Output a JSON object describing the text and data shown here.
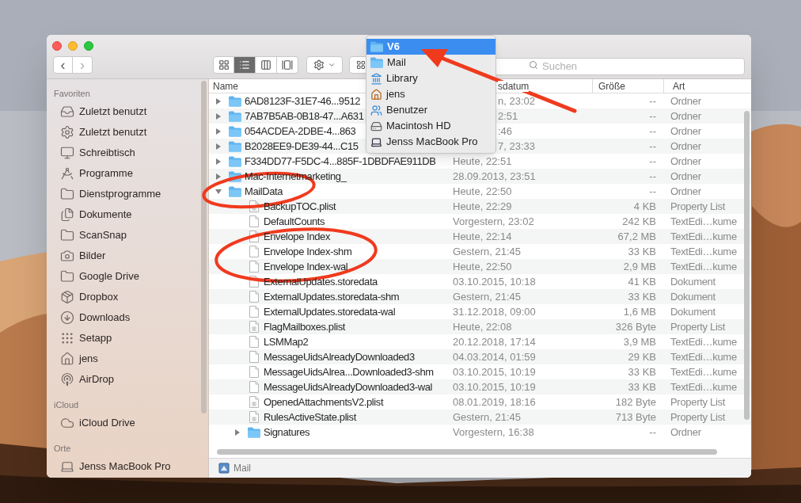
{
  "toolbar": {
    "nav": [
      "‹",
      "›"
    ],
    "view_buttons": [
      {
        "selected": false
      },
      {
        "selected": true
      },
      {
        "selected": false
      },
      {
        "selected": false
      }
    ],
    "search": {
      "placeholder": "Suchen"
    }
  },
  "path_menu": [
    {
      "label": "V6",
      "selected": true
    },
    {
      "label": "Mail",
      "selected": false
    },
    {
      "label": "Library",
      "selected": false
    },
    {
      "label": "jens",
      "selected": false
    },
    {
      "label": "Benutzer",
      "selected": false
    },
    {
      "label": "Macintosh HD",
      "selected": false
    },
    {
      "label": "Jenss MacBook Pro",
      "selected": false
    }
  ],
  "sidebar": [
    {
      "heading": "Favoriten",
      "items": [
        "Zuletzt benutzt",
        "Zuletzt benutzt",
        "Schreibtisch",
        "Programme",
        "Dienstprogramme",
        "Dokumente",
        "ScanSnap",
        "Bilder",
        "Google Drive",
        "Dropbox",
        "Downloads",
        "Setapp",
        "jens",
        "AirDrop"
      ]
    },
    {
      "heading": "iCloud",
      "items": [
        "iCloud Drive"
      ]
    },
    {
      "heading": "Orte",
      "items": [
        "Jenss MacBook Pro"
      ]
    }
  ],
  "table": {
    "columns": [
      "Name",
      "sdatum",
      "Größe",
      "Art"
    ],
    "rows": [
      {
        "kind": "folder",
        "name": "6AD8123F-31E7-46...9512",
        "date": "n, 23:02",
        "covered": true,
        "size": "--",
        "type": "Ordner",
        "expanded": false
      },
      {
        "kind": "folder",
        "name": "7AB7B5AB-0B18-47...A631",
        "date": "2:51",
        "covered": true,
        "size": "--",
        "type": "Ordner",
        "expanded": false
      },
      {
        "kind": "folder",
        "name": "054ACDEA-2DBE-4...863",
        "date": ":46",
        "covered": true,
        "size": "--",
        "type": "Ordner",
        "expanded": false
      },
      {
        "kind": "folder",
        "name": "B2028EE9-DE39-44...C15",
        "date": "7, 23:33",
        "covered": true,
        "size": "--",
        "type": "Ordner",
        "expanded": false
      },
      {
        "kind": "folder",
        "name": "F334DD77-F5DC-4...885F-1DBDFAE911DB",
        "date": "Heute, 22:51",
        "covered": false,
        "size": "--",
        "type": "Ordner",
        "expanded": false
      },
      {
        "kind": "folder",
        "name": "Mac-Internetmarketing_",
        "date": "28.09.2013, 23:51",
        "covered": false,
        "size": "--",
        "type": "Ordner",
        "expanded": false
      },
      {
        "kind": "folder",
        "name": "MailData",
        "date": "Heute, 22:50",
        "covered": false,
        "size": "--",
        "type": "Ordner",
        "expanded": true,
        "children": [
          {
            "kind": "plist",
            "name": "BackupTOC.plist",
            "date": "Heute, 22:29",
            "covered": false,
            "size": "4 KB",
            "type": "Property List"
          },
          {
            "kind": "file",
            "name": "DefaultCounts",
            "date": "Vorgestern, 23:02",
            "covered": false,
            "size": "242 KB",
            "type": "TextEdi…kume"
          },
          {
            "kind": "file",
            "name": "Envelope Index",
            "date": "Heute, 22:14",
            "covered": false,
            "size": "67,2 MB",
            "type": "TextEdi…kume"
          },
          {
            "kind": "file",
            "name": "Envelope Index-shm",
            "date": "Gestern, 21:45",
            "covered": false,
            "size": "33 KB",
            "type": "TextEdi…kume"
          },
          {
            "kind": "file",
            "name": "Envelope Index-wal",
            "date": "Heute, 22:50",
            "covered": false,
            "size": "2,9 MB",
            "type": "TextEdi…kume"
          },
          {
            "kind": "file",
            "name": "ExternalUpdates.storedata",
            "date": "03.10.2015, 10:18",
            "covered": false,
            "size": "41 KB",
            "type": "Dokument"
          },
          {
            "kind": "file",
            "name": "ExternalUpdates.storedata-shm",
            "date": "Gestern, 21:45",
            "covered": false,
            "size": "33 KB",
            "type": "Dokument"
          },
          {
            "kind": "file",
            "name": "ExternalUpdates.storedata-wal",
            "date": "31.12.2018, 09:00",
            "covered": false,
            "size": "1,6 MB",
            "type": "Dokument"
          },
          {
            "kind": "plist",
            "name": "FlagMailboxes.plist",
            "date": "Heute, 22:08",
            "covered": false,
            "size": "326 Byte",
            "type": "Property List"
          },
          {
            "kind": "file",
            "name": "LSMMap2",
            "date": "20.12.2018, 17:14",
            "covered": false,
            "size": "3,9 MB",
            "type": "TextEdi…kume"
          },
          {
            "kind": "file",
            "name": "MessageUidsAlreadyDownloaded3",
            "date": "04.03.2014, 01:59",
            "covered": false,
            "size": "29 KB",
            "type": "TextEdi…kume"
          },
          {
            "kind": "file",
            "name": "MessageUidsAlrea...Downloaded3-shm",
            "date": "03.10.2015, 10:19",
            "covered": false,
            "size": "33 KB",
            "type": "TextEdi…kume"
          },
          {
            "kind": "file",
            "name": "MessageUidsAlreadyDownloaded3-wal",
            "date": "03.10.2015, 10:19",
            "covered": false,
            "size": "33 KB",
            "type": "TextEdi…kume"
          },
          {
            "kind": "plist",
            "name": "OpenedAttachmentsV2.plist",
            "date": "08.01.2019, 18:16",
            "covered": false,
            "size": "182 Byte",
            "type": "Property List"
          },
          {
            "kind": "plist",
            "name": "RulesActiveState.plist",
            "date": "Gestern, 21:45",
            "covered": false,
            "size": "713 Byte",
            "type": "Property List"
          },
          {
            "kind": "folder",
            "name": "Signatures",
            "date": "Vorgestern, 16:38",
            "covered": false,
            "size": "--",
            "type": "Ordner",
            "expanded": false
          }
        ]
      }
    ]
  },
  "status_bar": {
    "label": "Mail"
  }
}
